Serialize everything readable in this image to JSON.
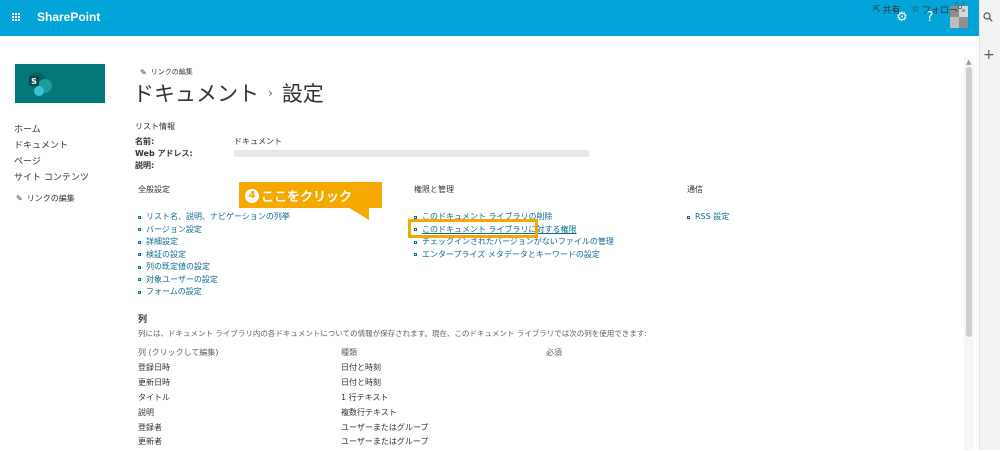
{
  "suite": {
    "app_name": "SharePoint",
    "gear_icon": "⚙",
    "help_icon": "?"
  },
  "command_bar": {
    "share_label": "共有",
    "follow_label": "フォロー"
  },
  "left_nav": {
    "items": [
      {
        "label": "ホーム"
      },
      {
        "label": "ドキュメント"
      },
      {
        "label": "ページ"
      },
      {
        "label": "サイト コンテンツ"
      }
    ],
    "edit_links": "リンクの編集"
  },
  "header": {
    "edit_links": "リンクの編集",
    "breadcrumb": [
      "ドキュメント",
      "設定"
    ],
    "separator": "›"
  },
  "list_info": {
    "heading": "リスト情報",
    "name_label": "名前:",
    "name_value": "ドキュメント",
    "web_address_label": "Web アドレス:",
    "description_label": "説明:"
  },
  "sections": {
    "general": {
      "heading": "全般設定",
      "links": [
        "リスト名、説明、ナビゲーションの列挙",
        "バージョン設定",
        "詳細設定",
        "検証の設定",
        "列の既定値の設定",
        "対象ユーザーの設定",
        "フォームの設定"
      ]
    },
    "permissions": {
      "heading": "権限と管理",
      "links": [
        "このドキュメント ライブラリの削除",
        "このドキュメント ライブラリに対する権限",
        "チェックインされたバージョンがないファイルの管理",
        "エンタープライズ メタデータとキーワードの設定"
      ],
      "highlighted_index": 1
    },
    "communication": {
      "heading": "通信",
      "links": [
        "RSS 設定"
      ]
    }
  },
  "callout": {
    "number": "4",
    "text": "ここをクリック",
    "color": "#f5a900"
  },
  "columns": {
    "heading": "列",
    "description": "列には、ドキュメント ライブラリ内の各ドキュメントについての情報が保存されます。現在、このドキュメント ライブラリでは次の列を使用できます:",
    "headers": [
      "列 (クリックして編集)",
      "種類",
      "必須"
    ],
    "rows": [
      {
        "name": "登録日時",
        "type": "日付と時刻"
      },
      {
        "name": "更新日時",
        "type": "日付と時刻"
      },
      {
        "name": "タイトル",
        "type": "1 行テキスト"
      },
      {
        "name": "説明",
        "type": "複数行テキスト"
      },
      {
        "name": "登録者",
        "type": "ユーザーまたはグループ"
      },
      {
        "name": "更新者",
        "type": "ユーザーまたはグループ"
      }
    ]
  },
  "colors": {
    "suite_bar": "#03a4d9",
    "site_logo": "#03787c",
    "link": "#0b6a8f",
    "highlight": "#f5a900"
  }
}
